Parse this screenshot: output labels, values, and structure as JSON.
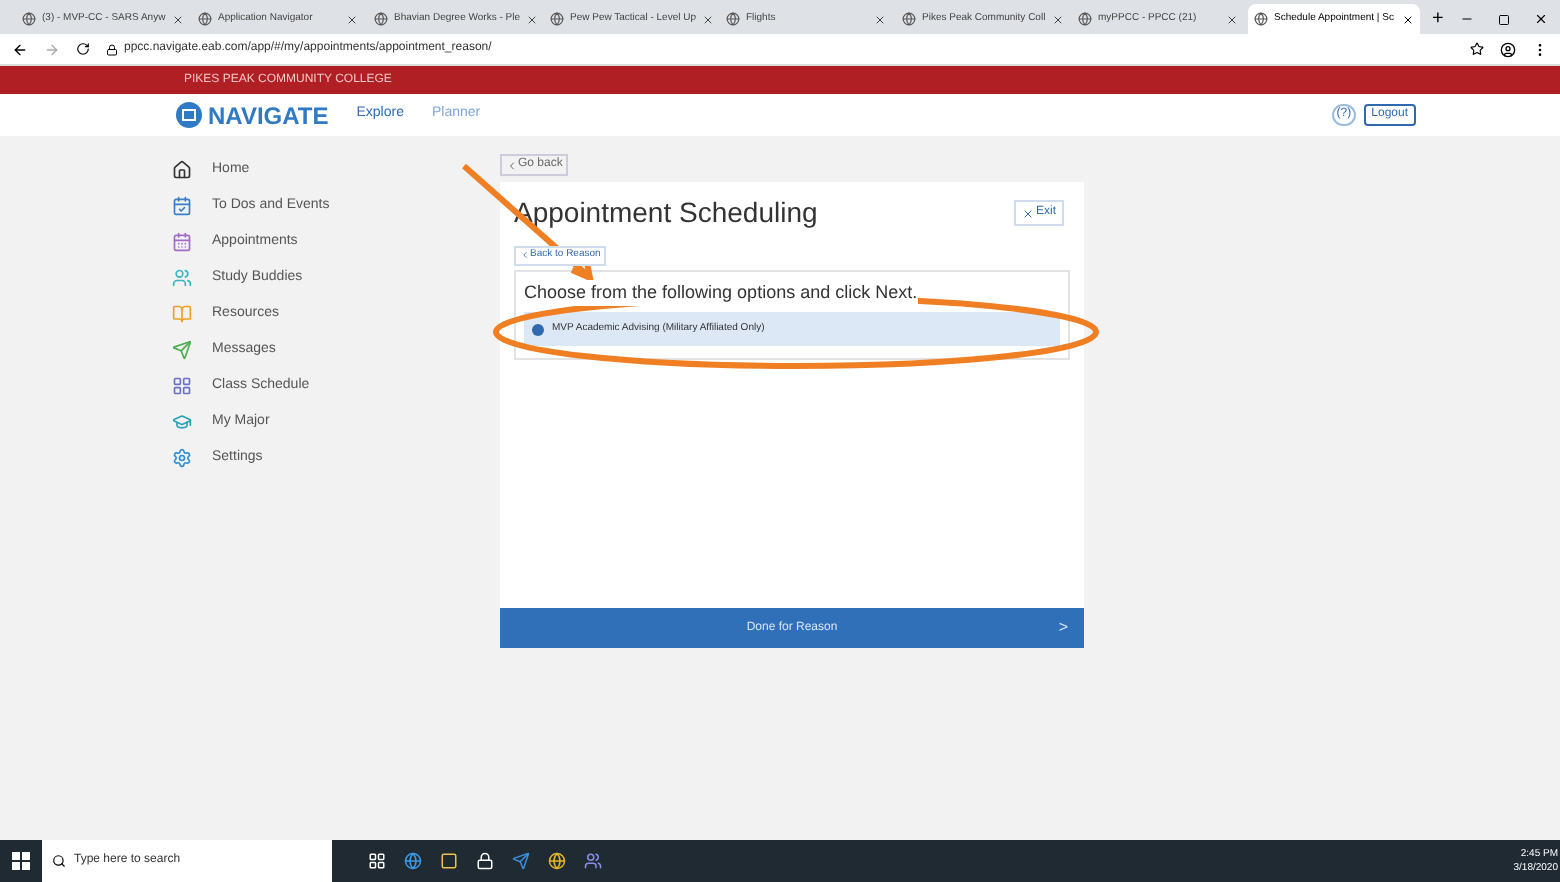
{
  "browser": {
    "tabs": [
      {
        "label": "(3) - MVP-CC - SARS Anyw",
        "selected": false
      },
      {
        "label": "Application Navigator",
        "selected": false
      },
      {
        "label": "Bhavian Degree Works - Ple",
        "selected": false
      },
      {
        "label": "Pew Pew Tactical - Level Up",
        "selected": false
      },
      {
        "label": "Flights",
        "selected": false
      },
      {
        "label": "Pikes Peak Community Coll",
        "selected": false
      },
      {
        "label": "myPPCC - PPCC (21)",
        "selected": false
      },
      {
        "label": "Schedule Appointment | Sc",
        "selected": true
      }
    ],
    "new_tab": "+",
    "url": "ppcc.navigate.eab.com/app/#/my/appointments/appointment_reason/"
  },
  "banner": "PIKES PEAK COMMUNITY COLLEGE",
  "header": {
    "logo": "NAVIGATE",
    "nav": [
      {
        "label": "Explore",
        "selected": true
      },
      {
        "label": "Planner",
        "selected": false
      }
    ],
    "help": "(?)",
    "logout": "Logout"
  },
  "sidebar": {
    "items": [
      {
        "label": "Home",
        "kind": "home"
      },
      {
        "label": "To Dos and Events",
        "kind": "todo"
      },
      {
        "label": "Appointments",
        "kind": "calendar"
      },
      {
        "label": "Study Buddies",
        "kind": "people"
      },
      {
        "label": "Resources",
        "kind": "book"
      },
      {
        "label": "Messages",
        "kind": "send"
      },
      {
        "label": "Class Schedule",
        "kind": "schedule"
      },
      {
        "label": "My Major",
        "kind": "cap"
      },
      {
        "label": "Settings",
        "kind": "gear"
      }
    ]
  },
  "main": {
    "go_back": "Go back",
    "title": "Appointment Scheduling",
    "exit": "Exit",
    "back_to": "Back to Reason",
    "prompt": "Choose from the following options and click Next.",
    "options": [
      {
        "label": "MVP Academic Advising (Military Affiliated Only)",
        "selected": true
      }
    ],
    "done": "Done for Reason",
    "done_arrow": ">"
  },
  "taskbar": {
    "search": "Type here to search",
    "time": "2:45 PM",
    "date": "3/18/2020"
  }
}
